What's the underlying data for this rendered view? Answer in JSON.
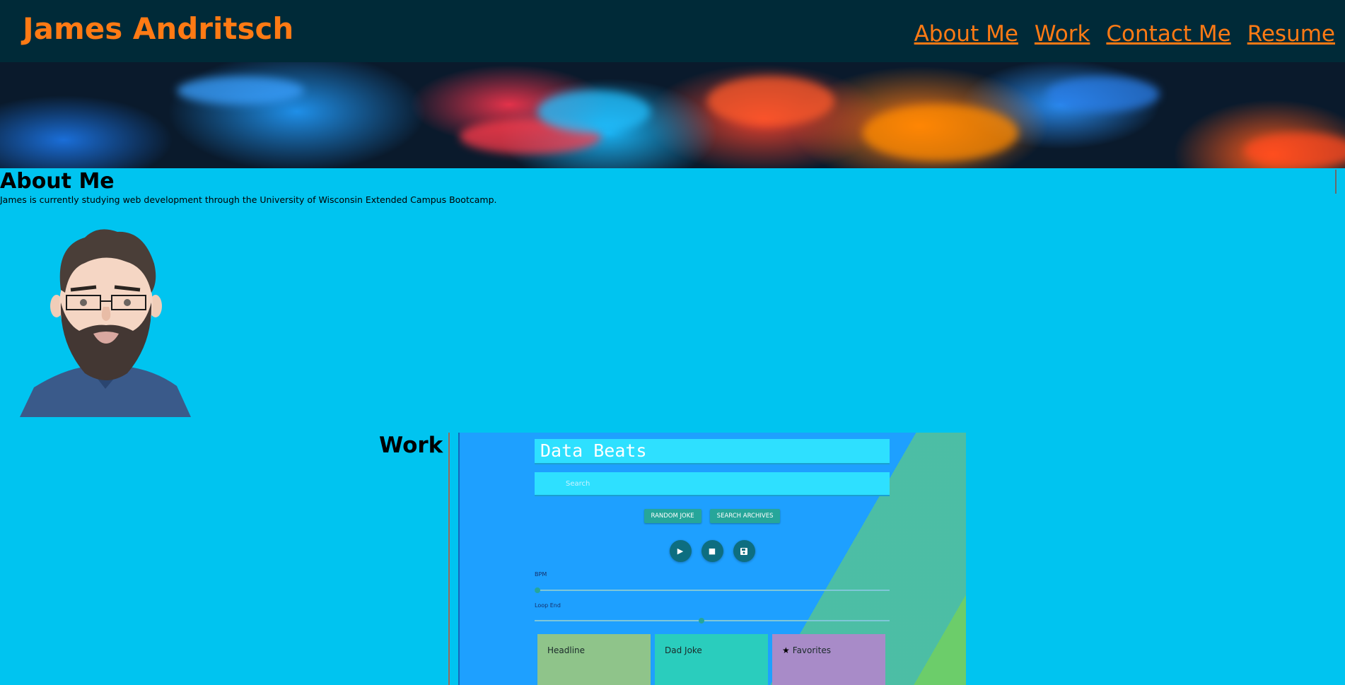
{
  "header": {
    "site_title": "James Andritsch",
    "nav": [
      "About Me",
      "Work",
      "Contact Me",
      "Resume"
    ],
    "accent_color": "#ff7a14",
    "background_color": "#002a38"
  },
  "about": {
    "heading": "About Me",
    "text": "James is currently studying web development through the University of Wisconsin Extended Campus Bootcamp.",
    "avatar_icon": "cartoon-avatar-bearded-man"
  },
  "work": {
    "heading": "Work",
    "project": {
      "title": "Data Beats",
      "search_placeholder": "Search",
      "buttons": [
        "RANDOM JOKE",
        "SEARCH ARCHIVES"
      ],
      "controls": [
        "play-icon",
        "stop-icon",
        "save-icon"
      ],
      "sliders": [
        {
          "label": "BPM",
          "value": 0
        },
        {
          "label": "Loop End",
          "value": 0.47
        }
      ],
      "cards": [
        "Headline",
        "Dad Joke",
        "Favorites"
      ]
    }
  },
  "page_background": "#00c4f0"
}
